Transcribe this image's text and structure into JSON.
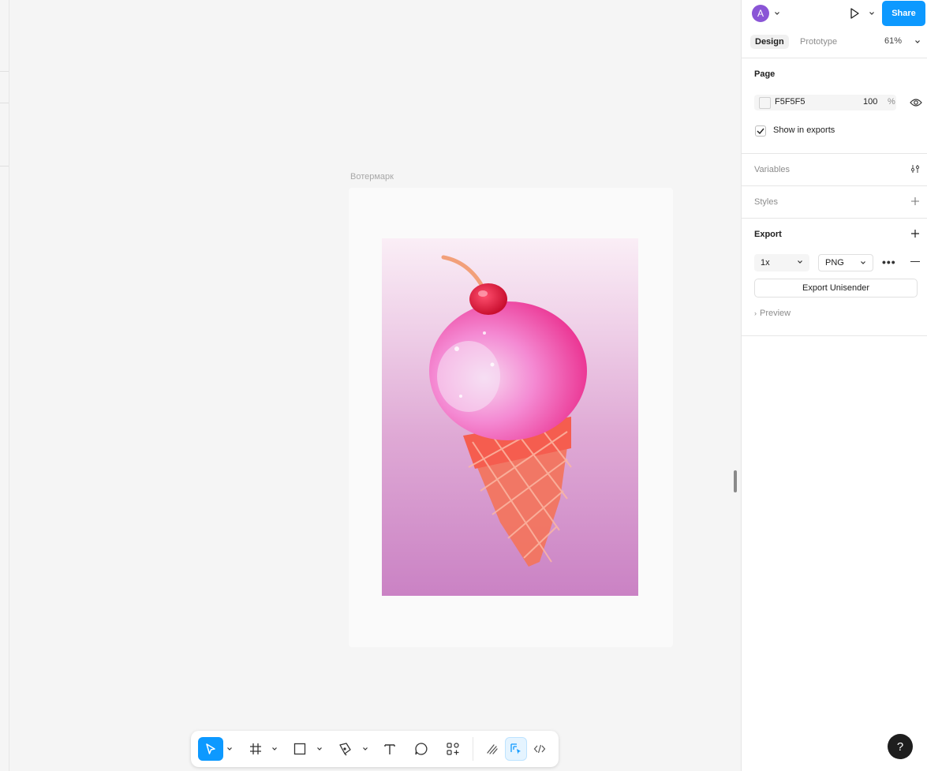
{
  "canvas": {
    "frame_name": "Вотермарк"
  },
  "toolbar": {
    "tools": [
      {
        "name": "move",
        "icon": "cursor-icon"
      },
      {
        "name": "frame",
        "icon": "frame-icon"
      },
      {
        "name": "shape",
        "icon": "rectangle-icon"
      },
      {
        "name": "pen",
        "icon": "pen-icon"
      },
      {
        "name": "text",
        "icon": "text-icon"
      },
      {
        "name": "comment",
        "icon": "comment-icon"
      },
      {
        "name": "actions",
        "icon": "actions-icon"
      },
      {
        "name": "draw",
        "icon": "draw-icon"
      },
      {
        "name": "design-mode",
        "icon": "design-mode-icon"
      },
      {
        "name": "dev-mode",
        "icon": "code-icon"
      }
    ],
    "active_tool": "move"
  },
  "header": {
    "avatar_initial": "A",
    "share_label": "Share",
    "tabs": [
      {
        "label": "Design",
        "active": true
      },
      {
        "label": "Prototype",
        "active": false
      }
    ],
    "zoom": "61%"
  },
  "page_section": {
    "title": "Page",
    "fill_hex": "F5F5F5",
    "opacity": "100",
    "opacity_unit": "%",
    "show_in_exports_label": "Show in exports",
    "show_in_exports_checked": true
  },
  "variables": {
    "title": "Variables"
  },
  "styles": {
    "title": "Styles"
  },
  "export": {
    "title": "Export",
    "scale": "1x",
    "format": "PNG",
    "button_label": "Export Unisender",
    "preview_label": "Preview"
  },
  "help_label": "?",
  "colors": {
    "accent": "#0d99ff",
    "avatar": "#8a55d6"
  }
}
